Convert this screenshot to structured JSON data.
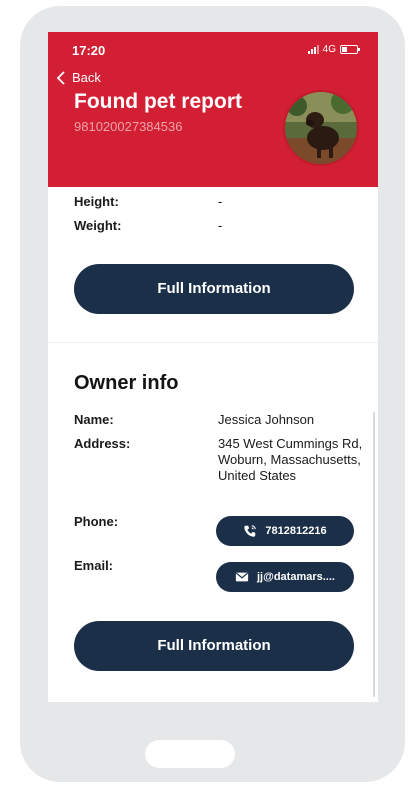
{
  "status": {
    "time": "17:20",
    "network": "4G"
  },
  "header": {
    "back_label": "Back",
    "title": "Found pet report",
    "chip_id": "981020027384536"
  },
  "pet_details": {
    "height_label": "Height:",
    "height_value": "-",
    "weight_label": "Weight:",
    "weight_value": "-"
  },
  "buttons": {
    "full_info_1": "Full Information",
    "full_info_2": "Full Information"
  },
  "owner": {
    "section_title": "Owner info",
    "name_label": "Name:",
    "name_value": "Jessica Johnson",
    "address_label": "Address:",
    "address_value": "345 West Cummings Rd, Woburn, Massachusetts, United States",
    "phone_label": "Phone:",
    "phone_value": "7812812216",
    "email_label": "Email:",
    "email_value": "jj@datamars...."
  },
  "icons": {
    "back": "chevron-left-icon",
    "phone": "phone-call-icon",
    "email": "mail-icon"
  },
  "colors": {
    "header": "#d21f33",
    "button": "#1b2f48",
    "frame": "#e6e7e9"
  }
}
